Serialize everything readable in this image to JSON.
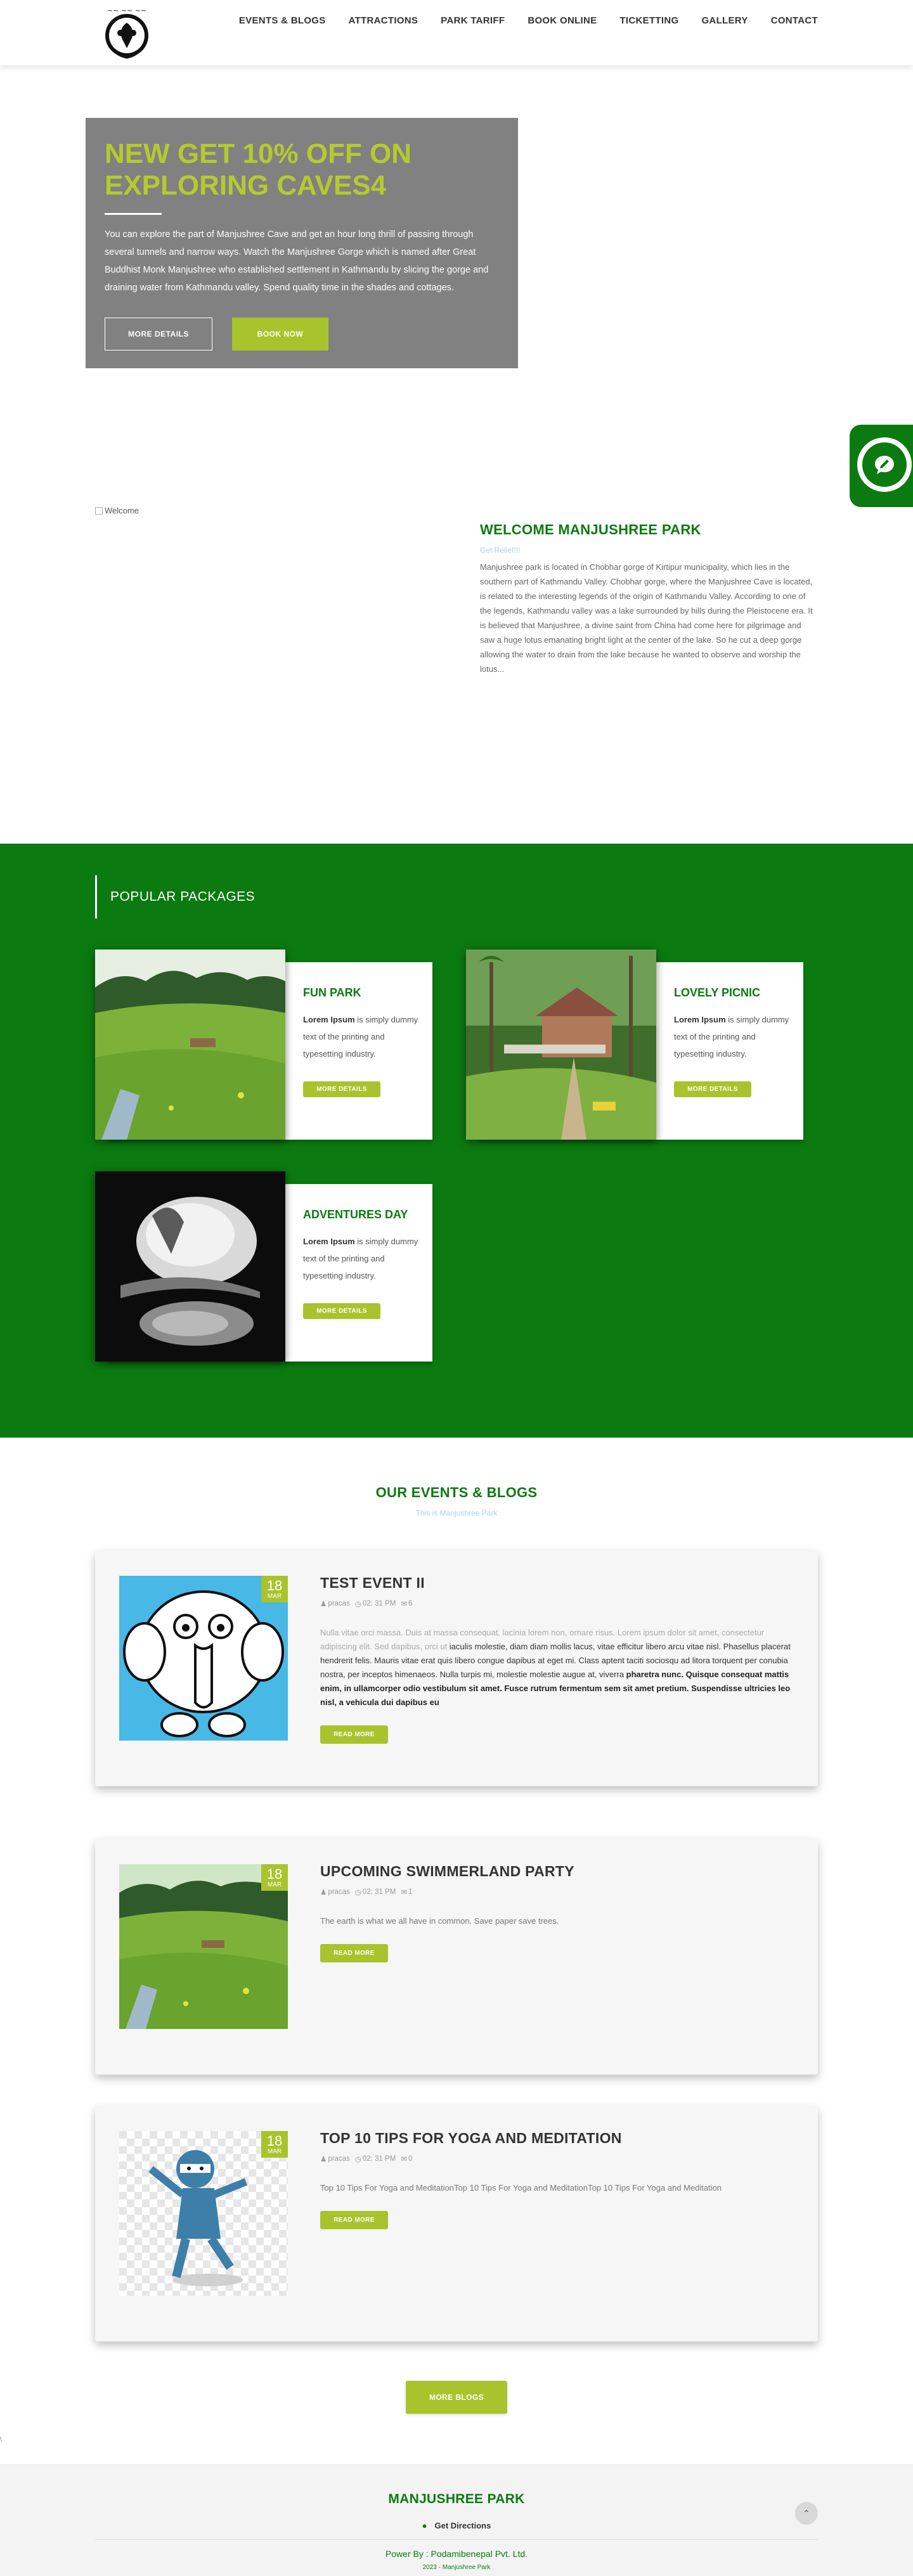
{
  "nav": {
    "items": [
      "EVENTS & BLOGS",
      "ATTRACTIONS",
      "PARK TARIFF",
      "BOOK ONLINE",
      "TICKETTING",
      "GALLERY",
      "CONTACT"
    ]
  },
  "hero": {
    "title": "NEW GET 10% OFF ON EXPLORING CAVES4",
    "text": "You can explore the part of Manjushree Cave and get an hour long thrill of passing through several tunnels and narrow ways. Watch the Manjushree Gorge which is named after Great Buddhist Monk Manjushree who established settlement in Kathmandu by slicing the gorge and draining water from Kathmandu valley. Spend quality time in the shades and cottages.",
    "more_details": "MORE DETAILS",
    "book_now": "BOOK NOW"
  },
  "welcome": {
    "image_alt": "Welcome",
    "title": "WELCOME MANJUSHREE PARK",
    "subtitle": "Get Relief!!!",
    "body": "Manjushree park is located in Chobhar gorge of Kirtipur municipality, which lies in the southern part of Kathmandu Valley. Chobhar gorge, where the Manjushree Cave is located, is related to the interesting legends of the origin of Kathmandu Valley. According to one of the legends, Kathmandu valley was a lake surrounded by hills during the Pleistocene era. It is believed that Manjushree, a divine saint from China had come here for pilgrimage and saw a huge lotus emanating bright light at the center of the lake. So he cut a deep gorge allowing the water to drain from the lake because he wanted to observe and worship the lotus..."
  },
  "packages": {
    "heading": "POPULAR PACKAGES",
    "items": [
      {
        "title": "FUN PARK",
        "desc_bold": "Lorem Ipsum",
        "desc": " is simply dummy text of the printing and typesetting industry.",
        "button": "MORE DETAILS"
      },
      {
        "title": "LOVELY PICNIC",
        "desc_bold": "Lorem Ipsum",
        "desc": " is simply dummy text of the printing and typesetting industry.",
        "button": "MORE DETAILS"
      },
      {
        "title": "ADVENTURES DAY",
        "desc_bold": "Lorem Ipsum",
        "desc": " is simply dummy text of the printing and typesetting industry.",
        "button": "MORE DETAILS"
      }
    ]
  },
  "events": {
    "title": "OUR EVENTS & BLOGS",
    "subtitle": "This is Manjushree Park",
    "items": [
      {
        "day": "18",
        "month": "MAR",
        "name": "TEST EVENT II",
        "author": "pracas",
        "time": "02: 31 PM",
        "comments": "6",
        "text_dim": "Nulla vitae orci massa. Duis at massa consequat, lacinia lorem non, ornare risus. Lorem ipsum dolor sit amet, consectetur adipiscing elit. Sed dapibus, orci ut ",
        "text_dark": "iaculis molestie, diam diam mollis lacus, vitae efficitur libero arcu vitae nisl. Phasellus placerat hendrerit felis. Mauris vitae erat quis libero congue dapibus at eget mi. Class aptent taciti sociosqu ad litora torquent per conubia nostra, per inceptos himenaeos. Nulla turpis mi, molestie molestie augue at, viverra ",
        "text_bold": "pharetra nunc. Quisque consequat mattis enim, in ullamcorper odio vestibulum sit amet. Fusce rutrum fermentum sem sit amet pretium. Suspendisse ultricies leo nisl, a vehicula dui dapibus eu",
        "button": "READ MORE"
      },
      {
        "day": "18",
        "month": "MAR",
        "name": "UPCOMING SWIMMERLAND PARTY",
        "author": "pracas",
        "time": "02: 31 PM",
        "comments": "1",
        "text": "The earth is what we all have in common. Save paper save trees.",
        "button": "READ MORE"
      },
      {
        "day": "18",
        "month": "MAR",
        "name": "TOP 10 TIPS FOR YOGA AND MEDITATION",
        "author": "pracas",
        "time": "02: 31 PM",
        "comments": "0",
        "text": "Top 10 Tips For Yoga and MeditationTop 10 Tips For Yoga and MeditationTop 10 Tips For Yoga and Meditation",
        "button": "READ MORE"
      }
    ],
    "more_blogs": "MORE BLOGS",
    "stray_char": "\\"
  },
  "footer": {
    "title": "MANJUSHREE PARK",
    "directions": "Get Directions",
    "power": "Power By : Podamibenepal Pvt. Ltd.",
    "year": "2023 - Manjushree Park"
  },
  "colors": {
    "brand_green": "#0b7a10",
    "accent_lime": "#a9c32d",
    "hero_box": "#818181"
  }
}
